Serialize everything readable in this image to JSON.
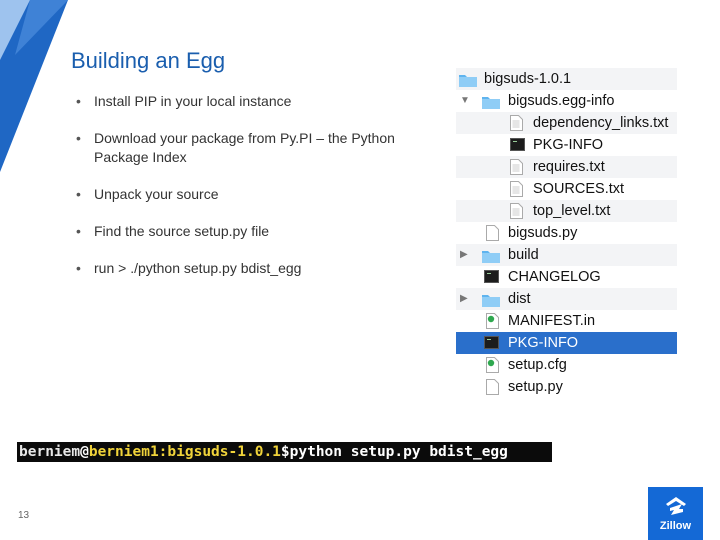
{
  "slide": {
    "title": "Building an Egg",
    "page_number": "13",
    "bullets": [
      "Install PIP in your local instance",
      "Download your package from Py.PI – the Python Package Index",
      "Unpack your source",
      "Find the source setup.py file",
      "run > ./python setup.py bdist_egg"
    ]
  },
  "finder": {
    "rows": [
      {
        "label": "bigsuds-1.0.1",
        "icon": "folder-icon"
      },
      {
        "label": "bigsuds.egg-info",
        "icon": "folder-icon",
        "expanded": true
      },
      {
        "label": "dependency_links.txt",
        "icon": "document-icon"
      },
      {
        "label": "PKG-INFO",
        "icon": "terminal-icon"
      },
      {
        "label": "requires.txt",
        "icon": "document-icon"
      },
      {
        "label": "SOURCES.txt",
        "icon": "document-icon"
      },
      {
        "label": "top_level.txt",
        "icon": "document-icon"
      },
      {
        "label": "bigsuds.py",
        "icon": "document-icon"
      },
      {
        "label": "build",
        "icon": "folder-icon",
        "expanded": false
      },
      {
        "label": "CHANGELOG",
        "icon": "terminal-icon"
      },
      {
        "label": "dist",
        "icon": "folder-icon",
        "expanded": false
      },
      {
        "label": "MANIFEST.in",
        "icon": "script-icon"
      },
      {
        "label": "PKG-INFO",
        "icon": "terminal-icon",
        "selected": true
      },
      {
        "label": "setup.cfg",
        "icon": "script-icon"
      },
      {
        "label": "setup.py",
        "icon": "document-icon"
      }
    ]
  },
  "terminal": {
    "user": "berniem",
    "at": "@",
    "host": "berniem1:bigsuds-1.0.1",
    "prompt": "$",
    "command": "python setup.py bdist_egg"
  },
  "logo": {
    "wordmark": "Zillow"
  },
  "colors": {
    "accent": "#1a5eae",
    "selection": "#2a6fcb",
    "logo_bg": "#1469d6"
  }
}
